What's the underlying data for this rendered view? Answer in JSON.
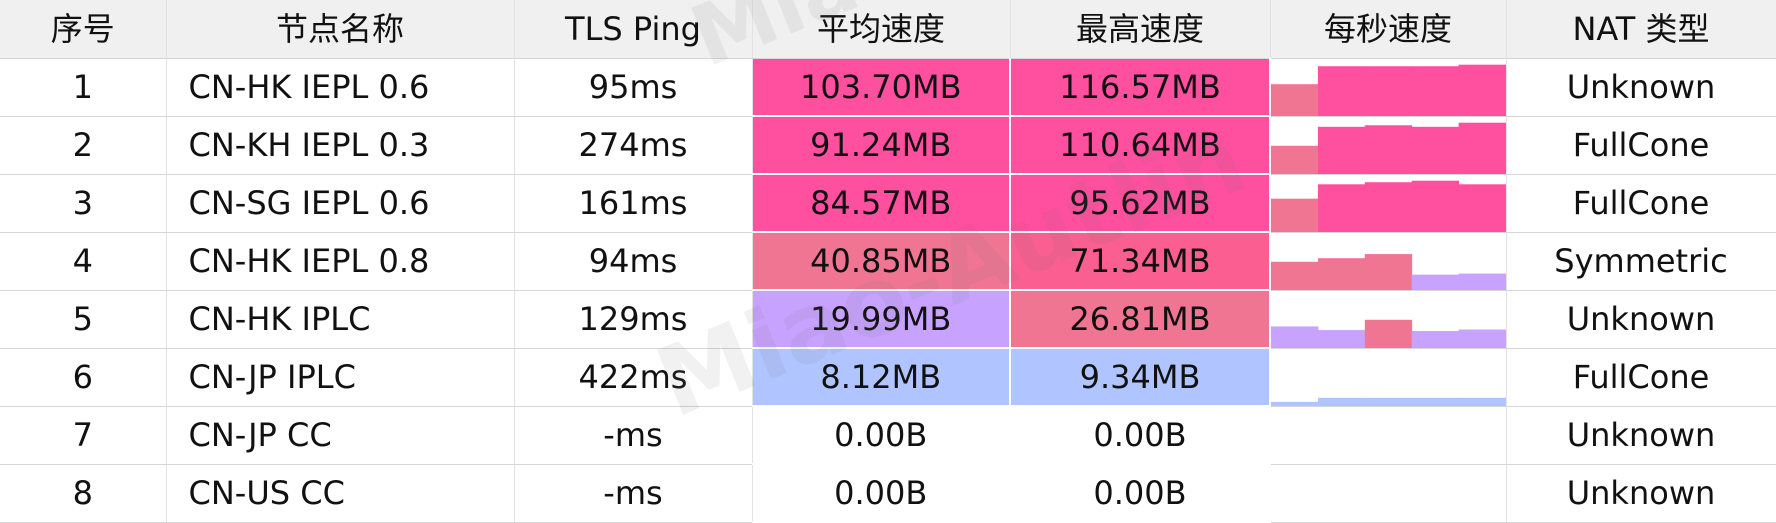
{
  "chart_data": {
    "type": "table",
    "columns": [
      "序号",
      "节点名称",
      "TLS Ping",
      "平均速度",
      "最高速度",
      "每秒速度",
      "NAT 类型"
    ],
    "rows": [
      {
        "index": "1",
        "name": "CN-HK IEPL 0.6",
        "ping": "95ms",
        "avg": "103.70MB",
        "max": "116.57MB",
        "nat": "Unknown",
        "avg_mb": 103.7,
        "max_mb": 116.57,
        "per_second": [
          0.62,
          0.97,
          0.97,
          0.97,
          1.0
        ]
      },
      {
        "index": "2",
        "name": "CN-KH IEPL 0.3",
        "ping": "274ms",
        "avg": "91.24MB",
        "max": "110.64MB",
        "nat": "FullCone",
        "avg_mb": 91.24,
        "max_mb": 110.64,
        "per_second": [
          0.55,
          0.92,
          0.95,
          0.92,
          1.0
        ]
      },
      {
        "index": "3",
        "name": "CN-SG IEPL 0.6",
        "ping": "161ms",
        "avg": "84.57MB",
        "max": "95.62MB",
        "nat": "FullCone",
        "avg_mb": 84.57,
        "max_mb": 95.62,
        "per_second": [
          0.65,
          0.93,
          0.97,
          1.0,
          0.93
        ]
      },
      {
        "index": "4",
        "name": "CN-HK IEPL 0.8",
        "ping": "94ms",
        "avg": "40.85MB",
        "max": "71.34MB",
        "nat": "Symmetric",
        "avg_mb": 40.85,
        "max_mb": 71.34,
        "per_second": [
          0.55,
          0.62,
          0.7,
          0.3,
          0.32
        ]
      },
      {
        "index": "5",
        "name": "CN-HK IPLC",
        "ping": "129ms",
        "avg": "19.99MB",
        "max": "26.81MB",
        "nat": "Unknown",
        "avg_mb": 19.99,
        "max_mb": 26.81,
        "per_second": [
          0.42,
          0.35,
          0.55,
          0.33,
          0.36
        ]
      },
      {
        "index": "6",
        "name": "CN-JP IPLC",
        "ping": "422ms",
        "avg": "8.12MB",
        "max": "9.34MB",
        "nat": "FullCone",
        "avg_mb": 8.12,
        "max_mb": 9.34,
        "per_second": [
          0.08,
          0.16,
          0.16,
          0.16,
          0.16
        ]
      },
      {
        "index": "7",
        "name": "CN-JP CC",
        "ping": "-ms",
        "avg": "0.00B",
        "max": "0.00B",
        "nat": "Unknown",
        "avg_mb": 0,
        "max_mb": 0,
        "per_second": [
          0,
          0,
          0,
          0,
          0
        ]
      },
      {
        "index": "8",
        "name": "CN-US CC",
        "ping": "-ms",
        "avg": "0.00B",
        "max": "0.00B",
        "nat": "Unknown",
        "avg_mb": 0,
        "max_mb": 0,
        "per_second": [
          0,
          0,
          0,
          0,
          0
        ]
      }
    ],
    "speed_colors": {
      "very_high": "#ff4f9f",
      "high": "#fb5e91",
      "mid_high": "#f07593",
      "mid": "#c8a2ff",
      "low": "#b0c5ff",
      "none": "#ffffff"
    }
  },
  "watermark": {
    "text_top": "Mia",
    "text_mid": "Miao-Autlin"
  }
}
